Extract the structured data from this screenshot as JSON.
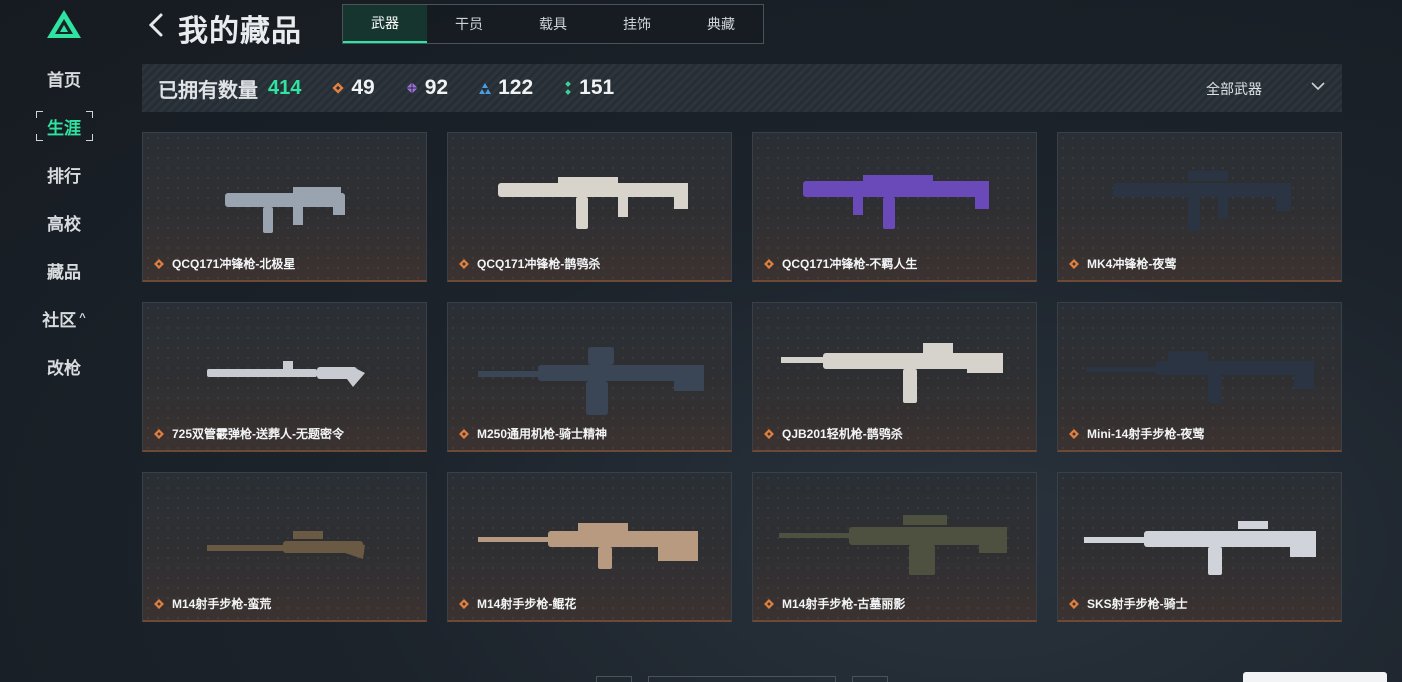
{
  "sidebar": {
    "items": [
      {
        "label": "首页",
        "active": false
      },
      {
        "label": "生涯",
        "active": true
      },
      {
        "label": "排行",
        "active": false
      },
      {
        "label": "高校",
        "active": false
      },
      {
        "label": "藏品",
        "active": false
      },
      {
        "label": "社区",
        "active": false,
        "caret": "^"
      },
      {
        "label": "改枪",
        "active": false
      }
    ]
  },
  "header": {
    "title": "我的藏品",
    "tabs": [
      {
        "label": "武器",
        "active": true
      },
      {
        "label": "干员",
        "active": false
      },
      {
        "label": "载具",
        "active": false
      },
      {
        "label": "挂饰",
        "active": false
      },
      {
        "label": "典藏",
        "active": false
      }
    ]
  },
  "stats": {
    "owned_label": "已拥有数量",
    "owned_count": "414",
    "tiers": [
      {
        "icon": "orange-diamond-icon",
        "color": "#e0803e",
        "value": "49"
      },
      {
        "icon": "purple-diamond-icon",
        "color": "#a070e0",
        "value": "92"
      },
      {
        "icon": "blue-triangle-icon",
        "color": "#4a9ee0",
        "value": "122"
      },
      {
        "icon": "green-dots-icon",
        "color": "#3ad39a",
        "value": "151"
      }
    ],
    "filter_label": "全部武器"
  },
  "colors": {
    "accent": "#2fe3a0",
    "rarity_orange": "#e0803e"
  },
  "weapons": [
    {
      "name": "QCQ171冲锋枪-北极星",
      "skin": "#9aa4b0"
    },
    {
      "name": "QCQ171冲锋枪-鹊鸮杀",
      "skin": "#d8d4cc"
    },
    {
      "name": "QCQ171冲锋枪-不羁人生",
      "skin": "#6a4ab8"
    },
    {
      "name": "MK4冲锋枪-夜莺",
      "skin": "#2a3442"
    },
    {
      "name": "725双管霰弹枪-送葬人-无题密令",
      "skin": "#c8ccd2"
    },
    {
      "name": "M250通用机枪-骑士精神",
      "skin": "#3a4656"
    },
    {
      "name": "QJB201轻机枪-鹊鸮杀",
      "skin": "#d6d2cc"
    },
    {
      "name": "Mini-14射手步枪-夜莺",
      "skin": "#2a3442"
    },
    {
      "name": "M14射手步枪-蛮荒",
      "skin": "#6a5a44"
    },
    {
      "name": "M14射手步枪-鲲花",
      "skin": "#b89a80"
    },
    {
      "name": "M14射手步枪-古墓丽影",
      "skin": "#4e5040"
    },
    {
      "name": "SKS射手步枪-骑士",
      "skin": "#d0d4da"
    }
  ]
}
